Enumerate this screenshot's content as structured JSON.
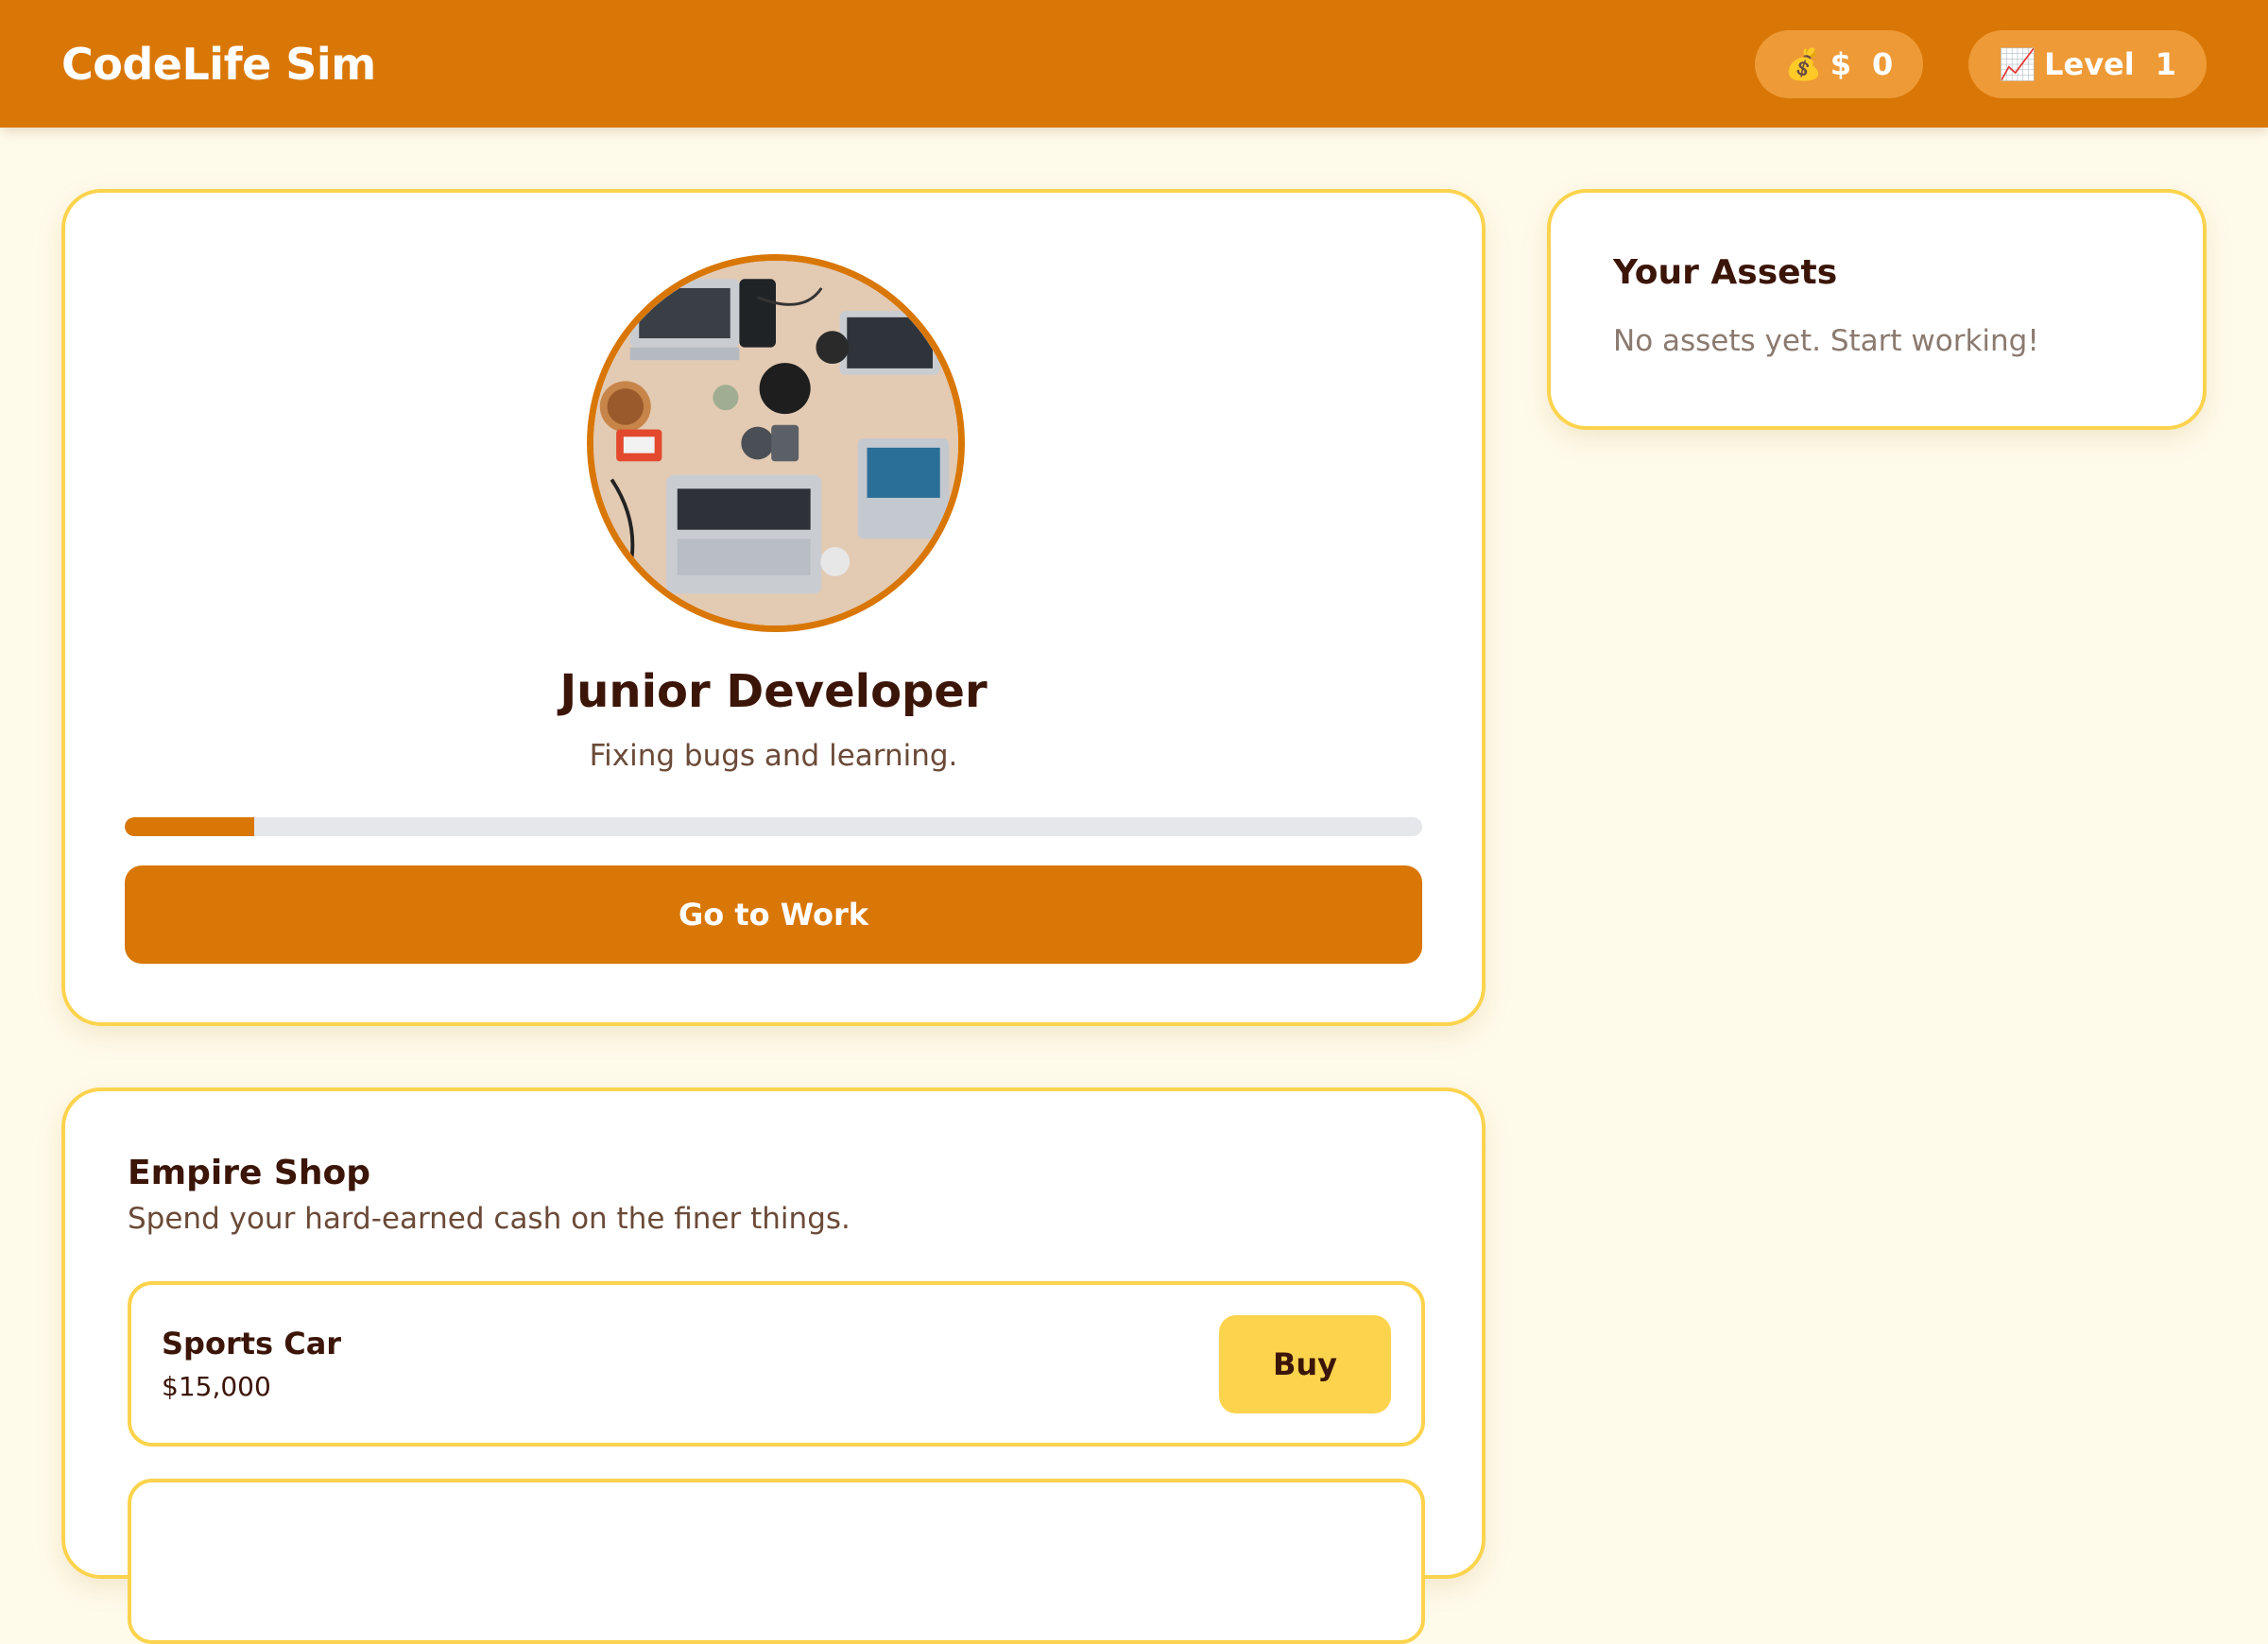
{
  "header": {
    "title": "CodeLife Sim",
    "money": {
      "icon": "money-bag-icon",
      "emoji": "💰",
      "label": "$",
      "value": "0"
    },
    "level": {
      "icon": "chart-up-icon",
      "emoji": "📈",
      "label": "Level",
      "value": "1"
    }
  },
  "job": {
    "title": "Junior Developer",
    "description": "Fixing bugs and learning.",
    "progress_percent": 10,
    "work_button_label": "Go to Work"
  },
  "assets": {
    "title": "Your Assets",
    "empty_text": "No assets yet. Start working!"
  },
  "shop": {
    "title": "Empire Shop",
    "subtitle": "Spend your hard-earned cash on the finer things.",
    "items": [
      {
        "name": "Sports Car",
        "price": "$15,000",
        "button_label": "Buy"
      }
    ]
  },
  "colors": {
    "primary": "#D97706",
    "accent": "#FCD34D",
    "background": "#FFFBEB",
    "text_dark": "#3B1507"
  }
}
